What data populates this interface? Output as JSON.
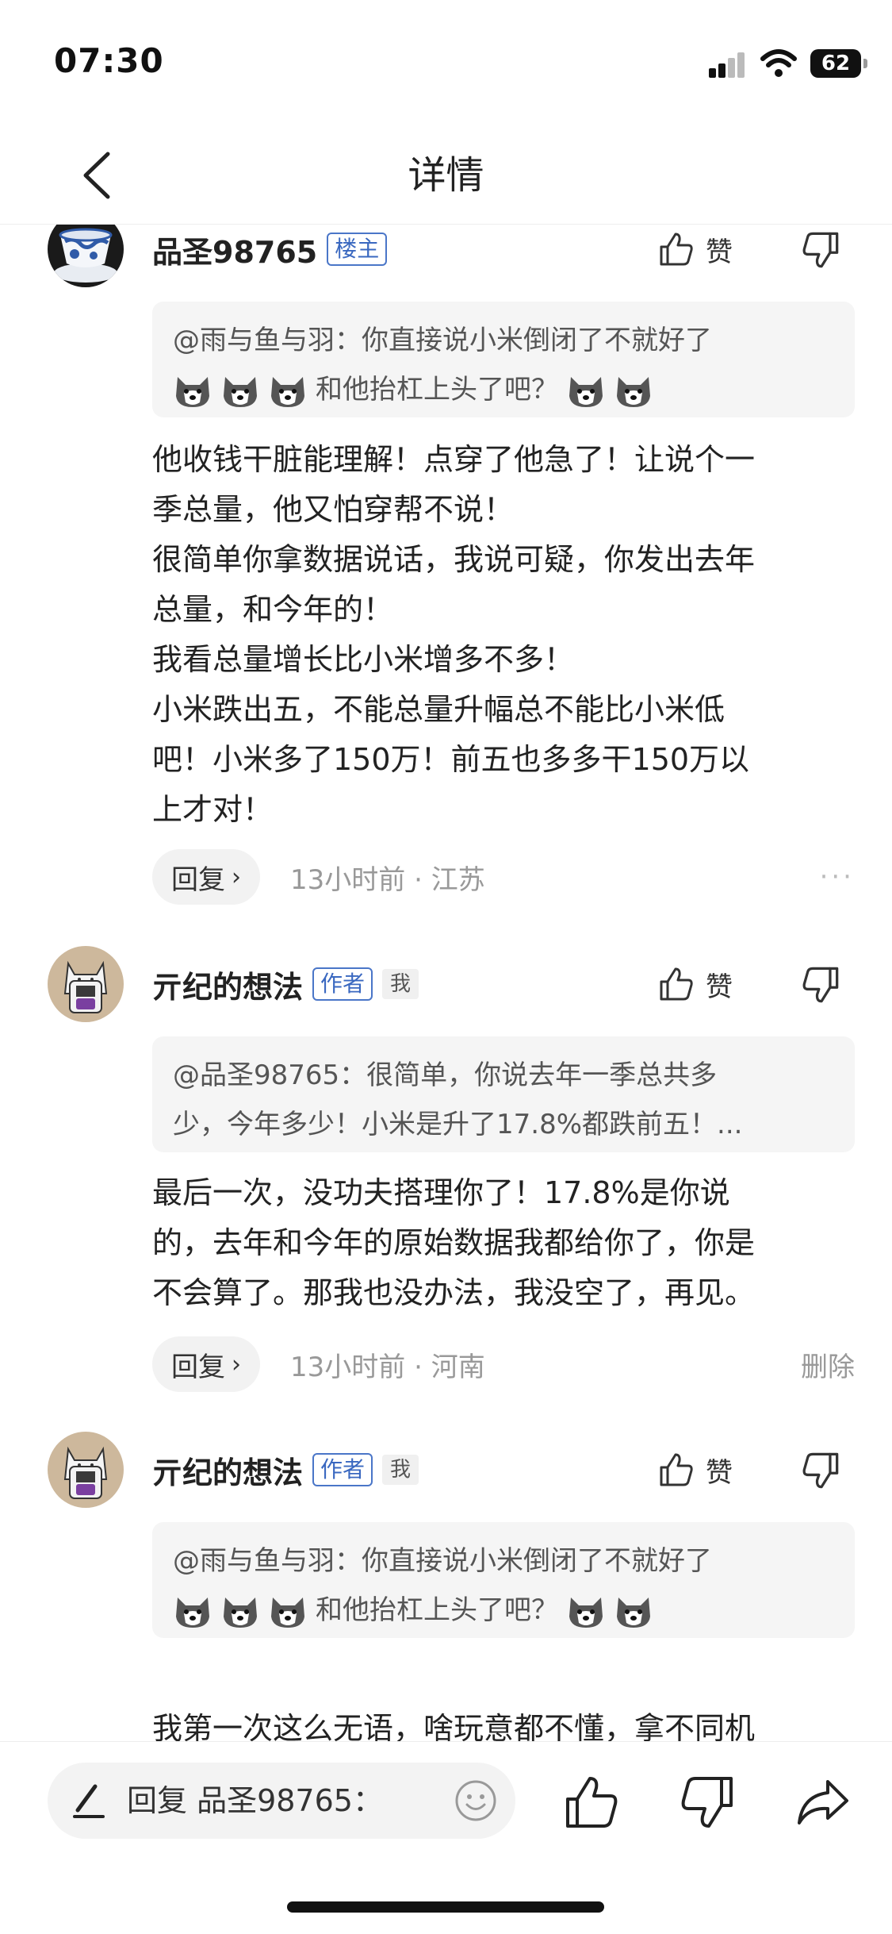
{
  "status": {
    "time": "07:30",
    "battery": "62"
  },
  "nav": {
    "title": "详情"
  },
  "comments": [
    {
      "username": "品圣98765",
      "tag": "楼主",
      "like_label": "赞",
      "quote_lines": [
        "@雨与鱼与羽：你直接说小米倒闭了不就好了",
        "和他抬杠上头了吧？"
      ],
      "body": "他收钱干脏能理解！点穿了他急了！让说个一\n季总量，他又怕穿帮不说！\n很简单你拿数据说话，我说可疑，你发出去年\n总量，和今年的！\n我看总量增长比小米增多不多！\n小米跌出五，不能总量升幅总不能比小米低\n吧！小米多了150万！前五也多多干150万以\n上才对！",
      "reply_label": "回复",
      "time": "13小时前",
      "location": "江苏",
      "more_label": "···"
    },
    {
      "username": "亓纪的想法",
      "tag": "作者",
      "me_tag": "我",
      "like_label": "赞",
      "quote_lines": [
        "@品圣98765：很简单，你说去年一季总共多",
        "少，今年多少！小米是升了17.8%都跌前五！..."
      ],
      "body": "最后一次，没功夫搭理你了！17.8%是你说\n的，去年和今年的原始数据我都给你了，你是\n不会算了。那我也没办法，我没空了，再见。",
      "reply_label": "回复",
      "time": "13小时前",
      "location": "河南",
      "delete_label": "删除"
    },
    {
      "username": "亓纪的想法",
      "tag": "作者",
      "me_tag": "我",
      "like_label": "赞",
      "quote_lines": [
        "@雨与鱼与羽：你直接说小米倒闭了不就好了",
        "和他抬杠上头了吧？"
      ],
      "body": "我第一次这么无语，啥玩意都不懂，拿不同机\n构的不同数据来分析，大开眼界了。"
    }
  ],
  "bottom_bar": {
    "input_placeholder": "回复 品圣98765："
  },
  "icons": {
    "back": "chevron-left-icon",
    "like": "thumbs-up-icon",
    "dislike": "thumbs-down-icon",
    "emoji_dog": "dog-face-icon",
    "laugh": "crying-laughing-icon",
    "pen": "pen-icon",
    "smile": "smile-icon",
    "share": "share-arrow-icon"
  }
}
